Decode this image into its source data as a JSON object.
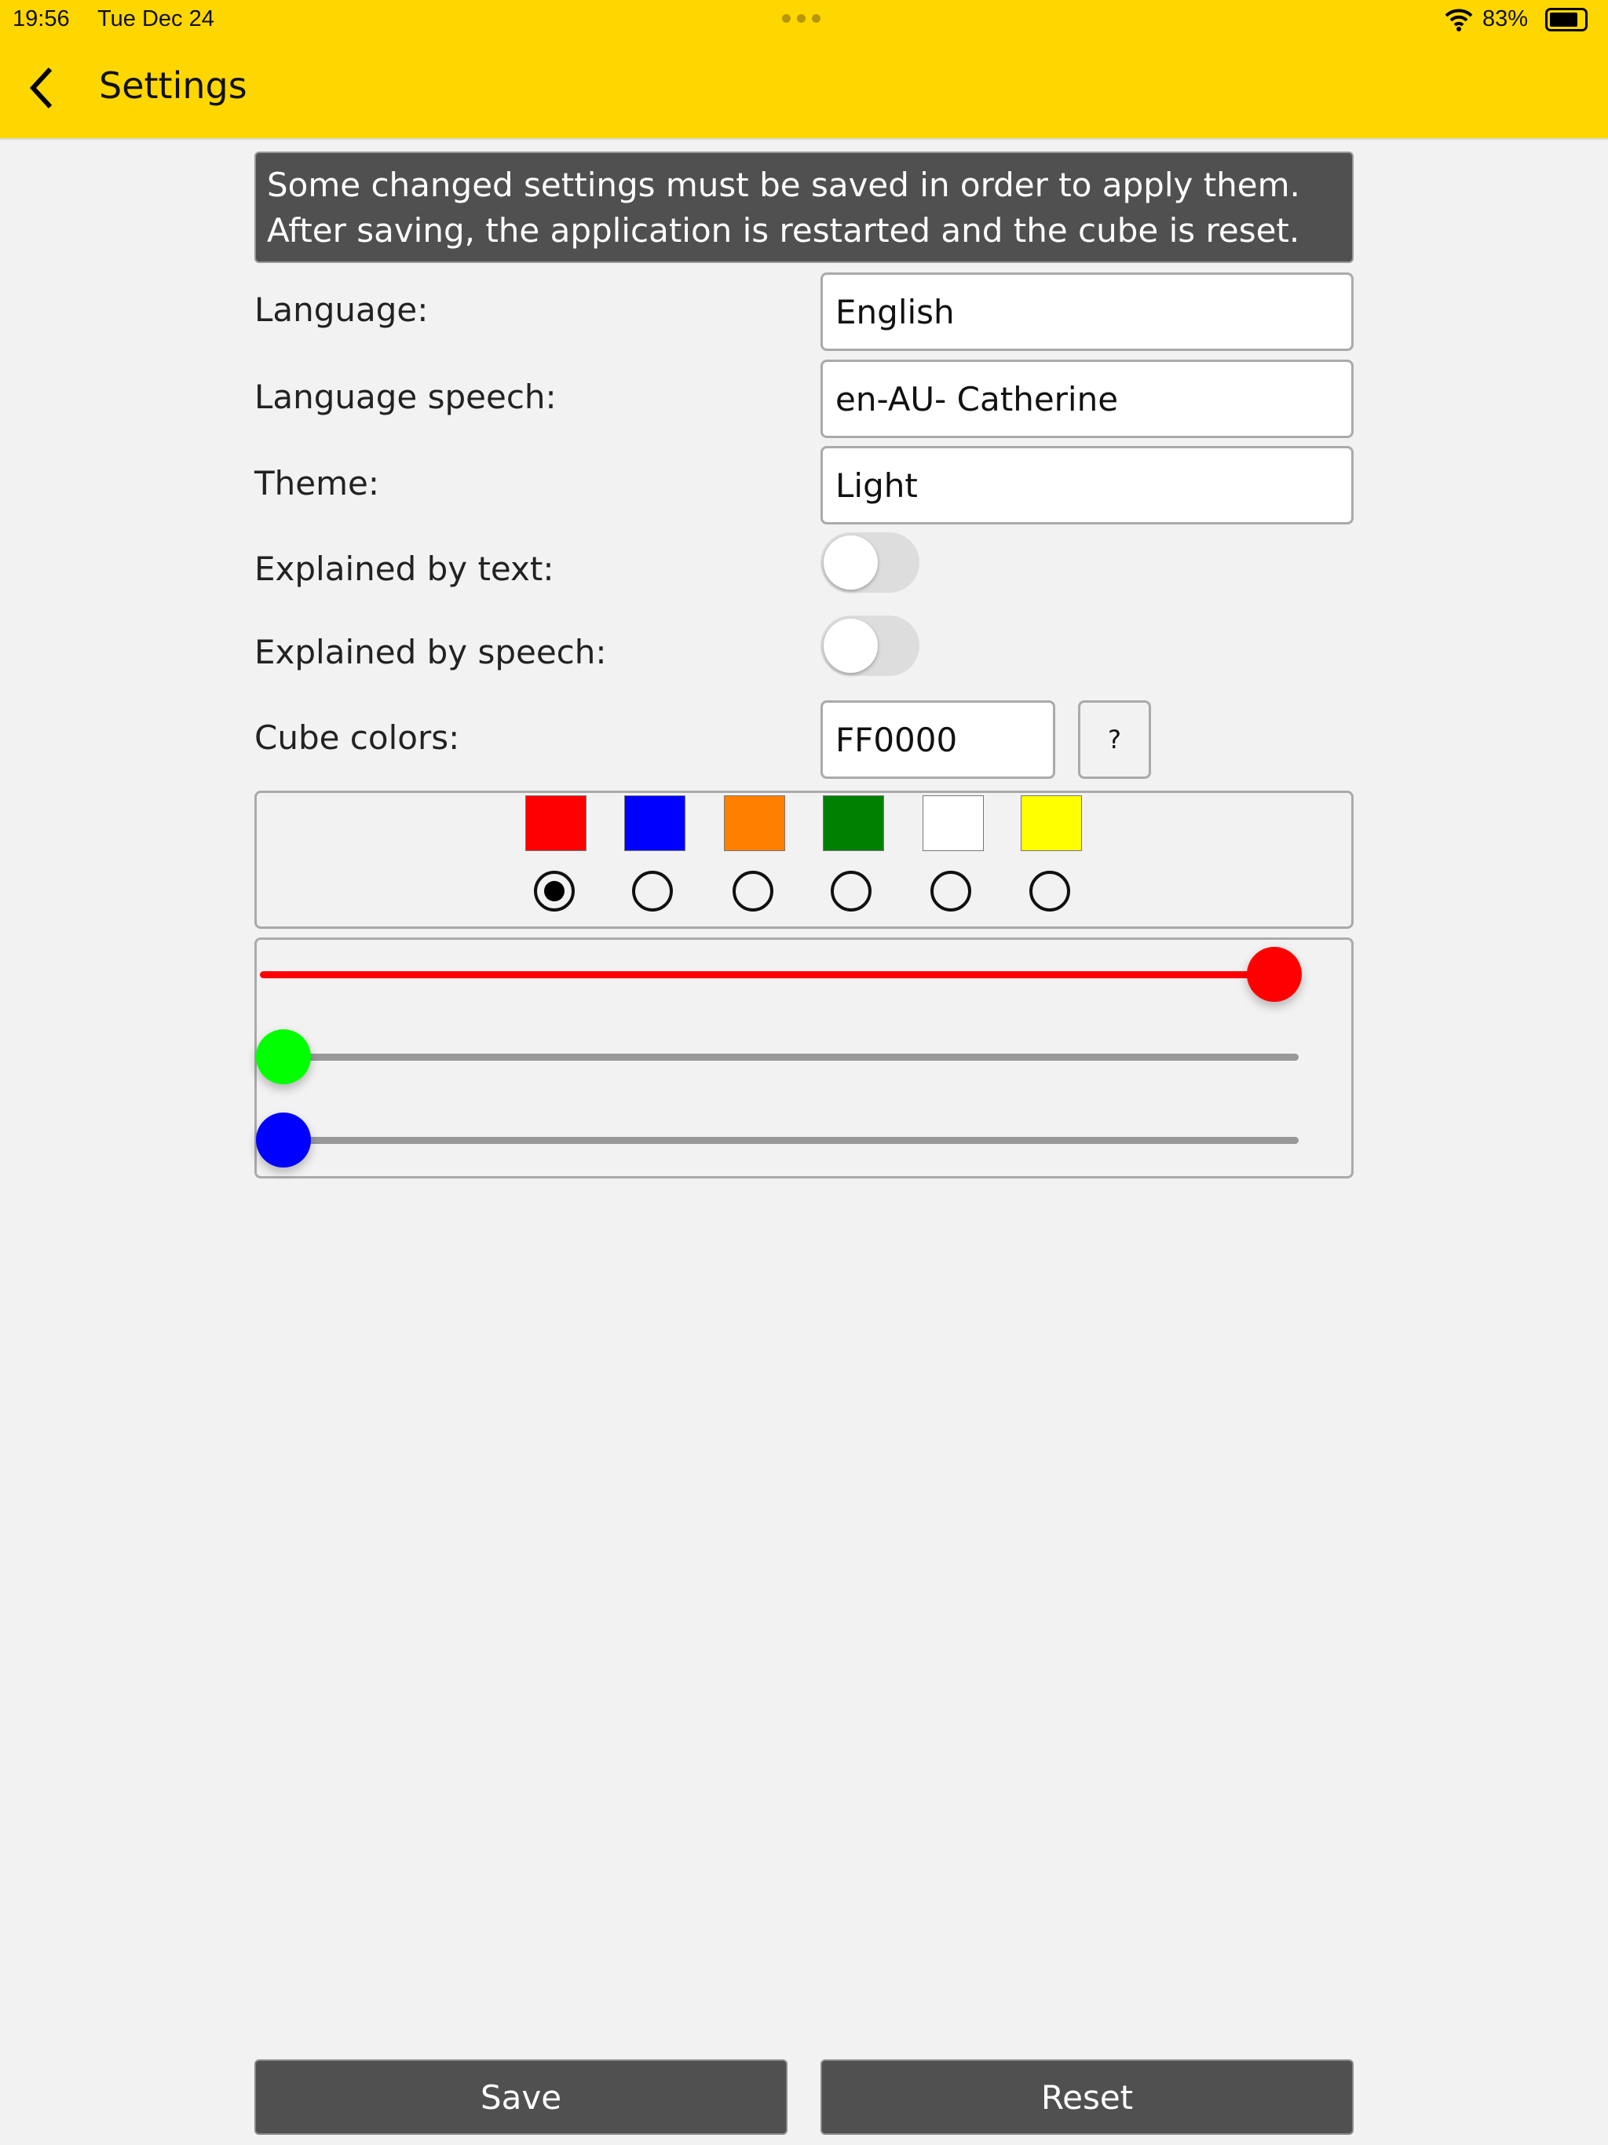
{
  "status_bar": {
    "time": "19:56",
    "date": "Tue Dec 24",
    "battery": "83%",
    "battery_level": 0.83
  },
  "nav": {
    "title": "Settings"
  },
  "banner": {
    "line1": "Some changed settings must be saved in order to apply them.",
    "line2": "After saving, the application is restarted and the cube is reset."
  },
  "settings": {
    "language": {
      "label": "Language:",
      "value": "English"
    },
    "language_speech": {
      "label": "Language speech:",
      "value": "en-AU- Catherine"
    },
    "theme": {
      "label": "Theme:",
      "value": "Light"
    },
    "explained_text": {
      "label": "Explained by text:",
      "on": false
    },
    "explained_speech": {
      "label": "Explained by speech:",
      "on": false
    },
    "cube_colors": {
      "label": "Cube colors:",
      "value": "FF0000",
      "help": "?"
    }
  },
  "palette": {
    "colors": [
      "#FF0000",
      "#0000FF",
      "#FF8000",
      "#008000",
      "#FFFFFF",
      "#FFFF00"
    ],
    "selected": 0
  },
  "rgb_sliders": {
    "red": 255,
    "green": 0,
    "blue": 0,
    "max": 255
  },
  "buttons": {
    "save": "Save",
    "reset": "Reset"
  }
}
